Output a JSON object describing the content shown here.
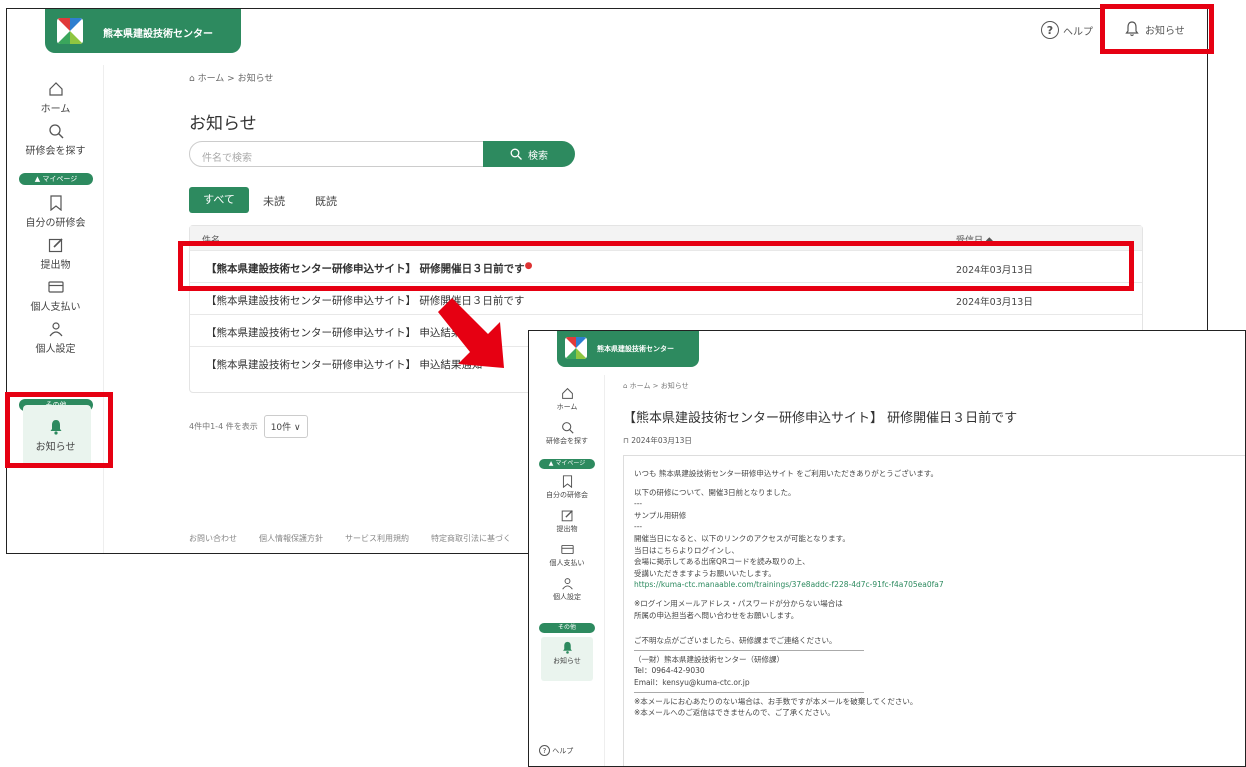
{
  "app": {
    "title": "熊本県建設技術センター"
  },
  "header": {
    "help_label": "ヘルプ",
    "notice_label": "お知らせ"
  },
  "sidebar": {
    "home": "ホーム",
    "search": "研修会を探す",
    "mypage_section": "▲ マイページ",
    "my_courses": "自分の研修会",
    "submissions": "提出物",
    "payments": "個人支払い",
    "settings": "個人設定",
    "other_section": "その他",
    "notices": "お知らせ"
  },
  "list_page": {
    "breadcrumb": "⌂ ホーム > お知らせ",
    "title": "お知らせ",
    "search": {
      "placeholder": "件名で検索",
      "button": "検索"
    },
    "tabs": [
      "すべて",
      "未読",
      "既読"
    ],
    "columns": {
      "subject": "件名",
      "received": "受信日 ◆"
    },
    "rows": [
      {
        "subject": "【熊本県建設技術センター研修申込サイト】 研修開催日３日前です",
        "date": "2024年03月13日",
        "unread": true
      },
      {
        "subject": "【熊本県建設技術センター研修申込サイト】 研修開催日３日前です",
        "date": "2024年03月13日",
        "unread": false
      },
      {
        "subject": "【熊本県建設技術センター研修申込サイト】 申込結果通知",
        "date": "",
        "unread": false
      },
      {
        "subject": "【熊本県建設技術センター研修申込サイト】 申込結果通知",
        "date": "",
        "unread": false
      }
    ],
    "pager": {
      "summary": "4件中1-4 件を表示",
      "per_page": "10件 ∨"
    },
    "footer": [
      "お問い合わせ",
      "個人情報保護方針",
      "サービス利用規約",
      "特定商取引法に基づく"
    ]
  },
  "detail_page": {
    "breadcrumb": "⌂ ホーム > お知らせ",
    "title": "【熊本県建設技術センター研修申込サイト】 研修開催日３日前です",
    "date": "⊓ 2024年03月13日",
    "body_lines": [
      "いつも 熊本県建設技術センター研修申込サイト をご利用いただきありがとうございます。",
      "",
      "以下の研修について、開催3日前となりました。",
      "---",
      "サンプル用研修",
      "---",
      "開催当日になると、以下のリンクのアクセスが可能となります。",
      "当日はこちらよりログインし、",
      "会場に掲示してある出席QRコードを読み取りの上、",
      "受講いただきますようお願いいたします。",
      "https://kuma-ctc.manaable.com/trainings/37e8addc-f228-4d7c-91fc-f4a705ea0fa7",
      "",
      "※ログイン用メールアドレス・パスワードが分からない場合は",
      "所属の申込担当者へ問い合わせをお願いします。",
      "",
      "",
      "ご不明な点がございましたら、研修課までご連絡ください。",
      "RULE",
      "（一財）熊本県建設技術センター（研修課）",
      "Tel：0964-42-9030",
      "Email：kensyu@kuma-ctc.or.jp",
      "RULE",
      "※本メールにお心あたりのない場合は、お手数ですが本メールを破棄してください。",
      "※本メールへのご返信はできませんので、ご了承ください。"
    ],
    "help_label": "ヘルプ"
  },
  "colors": {
    "brand_green": "#2d8a5f",
    "highlight_red": "#e60012"
  }
}
